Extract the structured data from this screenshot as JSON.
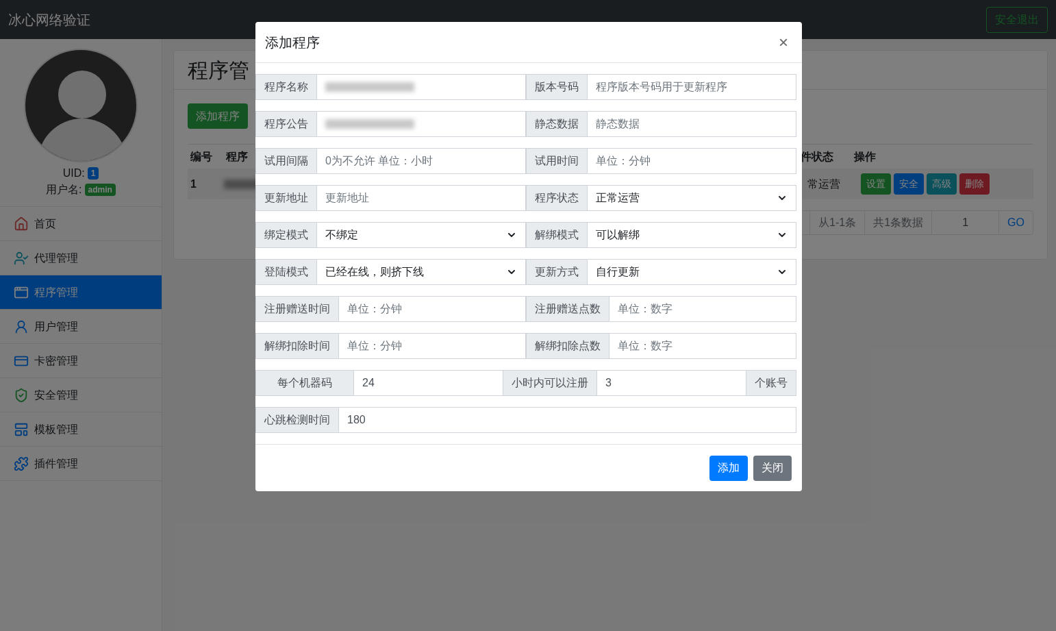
{
  "navbar": {
    "brand": "冰心网络验证",
    "logout": "安全退出"
  },
  "sidebar": {
    "uid_label": "UID:",
    "uid": "1",
    "user_label": "用户名:",
    "user": "admin",
    "items": [
      {
        "label": "首页",
        "selected": false
      },
      {
        "label": "代理管理",
        "selected": false
      },
      {
        "label": "程序管理",
        "selected": true
      },
      {
        "label": "用户管理",
        "selected": false
      },
      {
        "label": "卡密管理",
        "selected": false
      },
      {
        "label": "安全管理",
        "selected": false
      },
      {
        "label": "模板管理",
        "selected": false
      },
      {
        "label": "插件管理",
        "selected": false
      }
    ]
  },
  "page": {
    "title": "程序管",
    "add_button": "添加程序",
    "columns_left": [
      "编号",
      "程序"
    ],
    "columns_right": [
      "件状态",
      "操作"
    ],
    "row": {
      "id": "1",
      "status": "常运营",
      "actions": [
        {
          "label": "设置",
          "color": "#145322"
        },
        {
          "label": "安全",
          "color": "#003f7f"
        },
        {
          "label": "高级",
          "color": "#0b515c"
        },
        {
          "label": "删除",
          "color": "#6e1a22"
        }
      ]
    },
    "pagination": {
      "range": "从1-1条",
      "total": "共1条数据",
      "page": "1",
      "go": "GO"
    }
  },
  "modal": {
    "title": "添加程序",
    "close": "×",
    "rows": [
      [
        {
          "label": "程序名称",
          "kind": "blurred"
        },
        {
          "label": "版本号码",
          "kind": "input",
          "placeholder": "程序版本号码用于更新程序"
        }
      ],
      [
        {
          "label": "程序公告",
          "kind": "blurred"
        },
        {
          "label": "静态数据",
          "kind": "input",
          "placeholder": "静态数据"
        }
      ],
      [
        {
          "label": "试用间隔",
          "kind": "input",
          "placeholder": "0为不允许 单位：小时"
        },
        {
          "label": "试用时间",
          "kind": "input",
          "placeholder": "单位：分钟"
        }
      ],
      [
        {
          "label": "更新地址",
          "kind": "input",
          "placeholder": "更新地址"
        },
        {
          "label": "程序状态",
          "kind": "select",
          "value": "正常运营"
        }
      ],
      [
        {
          "label": "绑定模式",
          "kind": "select",
          "value": "不绑定"
        },
        {
          "label": "解绑模式",
          "kind": "select",
          "value": "可以解绑"
        }
      ],
      [
        {
          "label": "登陆模式",
          "kind": "select",
          "value": "已经在线，则挤下线"
        },
        {
          "label": "更新方式",
          "kind": "select",
          "value": "自行更新"
        }
      ],
      [
        {
          "label": "注册赠送时间",
          "kind": "input",
          "placeholder": "单位：分钟"
        },
        {
          "label": "注册赠送点数",
          "kind": "input",
          "placeholder": "单位：数字"
        }
      ],
      [
        {
          "label": "解绑扣除时间",
          "kind": "input",
          "placeholder": "单位：分钟"
        },
        {
          "label": "解绑扣除点数",
          "kind": "input",
          "placeholder": "单位：数字"
        }
      ]
    ],
    "register_limit": {
      "label1": "每个机器码",
      "value1": "24",
      "label2": "小时内可以注册",
      "value2": "3",
      "label3": "个账号"
    },
    "heartbeat": {
      "label": "心跳检测时间",
      "value": "180"
    },
    "buttons": [
      {
        "label": "添加",
        "kind": "primary"
      },
      {
        "label": "关闭",
        "kind": "secondary"
      }
    ]
  }
}
